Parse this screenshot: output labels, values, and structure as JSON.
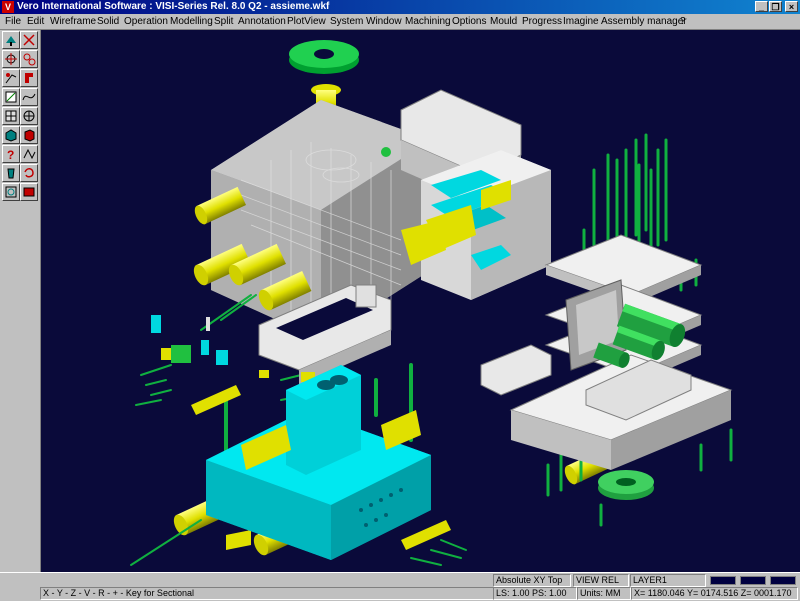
{
  "window": {
    "title": "Vero International Software : VISI-Series Rel. 8.0 Q2 - assieme.wkf",
    "logo_letter": "V",
    "minimize_glyph": "_",
    "restore_glyph": "❐",
    "close_glyph": "×"
  },
  "menu": {
    "items": [
      "File",
      "Edit",
      "Wireframe",
      "Solid",
      "Operation",
      "Modelling",
      "Split",
      "Annotation",
      "PlotView",
      "System",
      "Window",
      "Machining",
      "Options",
      "Mould",
      "Progress",
      "Imagine",
      "Assembly manager",
      "?"
    ]
  },
  "toolbar": {
    "icons": [
      "pan-icon",
      "zoom-icon",
      "rotate-icon",
      "fit-icon",
      "move-icon",
      "copy-icon",
      "scale-icon",
      "curve-icon",
      "grid-icon",
      "view-icon",
      "solid-box-icon",
      "shade-icon",
      "help-icon",
      "measure-icon",
      "undo-icon",
      "delete-icon",
      "zoom-window-icon",
      "redraw-icon"
    ]
  },
  "status": {
    "hint": "X - Y - Z - V - R -  +  - Key for Sectional",
    "view_mode": "Absolute XY Top",
    "view_rel": "VIEW REL",
    "layer": "LAYER1",
    "ls_ps": "LS: 1.00 PS: 1.00",
    "units": "Units: MM",
    "coords": "X= 1180.046 Y= 0174.516 Z= 0001.170"
  },
  "colors": {
    "viewport_bg": "#0a0a3a",
    "part_grey": "#b8b8b8",
    "part_white": "#e8e8e8",
    "part_cyan": "#00d8e0",
    "part_yellow": "#e0e000",
    "part_green": "#00b030"
  }
}
